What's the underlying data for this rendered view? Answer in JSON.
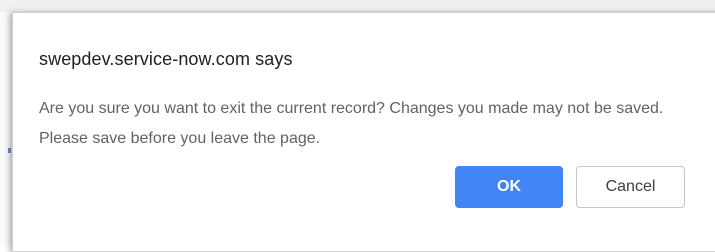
{
  "dialog": {
    "title": "swepdev.service-now.com says",
    "message": "Are you sure you want to exit the current record? Changes you made may not be saved. Please save before you leave the page.",
    "ok_label": "OK",
    "cancel_label": "Cancel"
  },
  "colors": {
    "ok_button_bg": "#4285f4",
    "ok_button_text": "#ffffff",
    "cancel_button_border": "#c5c5c5",
    "title_text": "#202124",
    "message_text": "#5f6368"
  }
}
